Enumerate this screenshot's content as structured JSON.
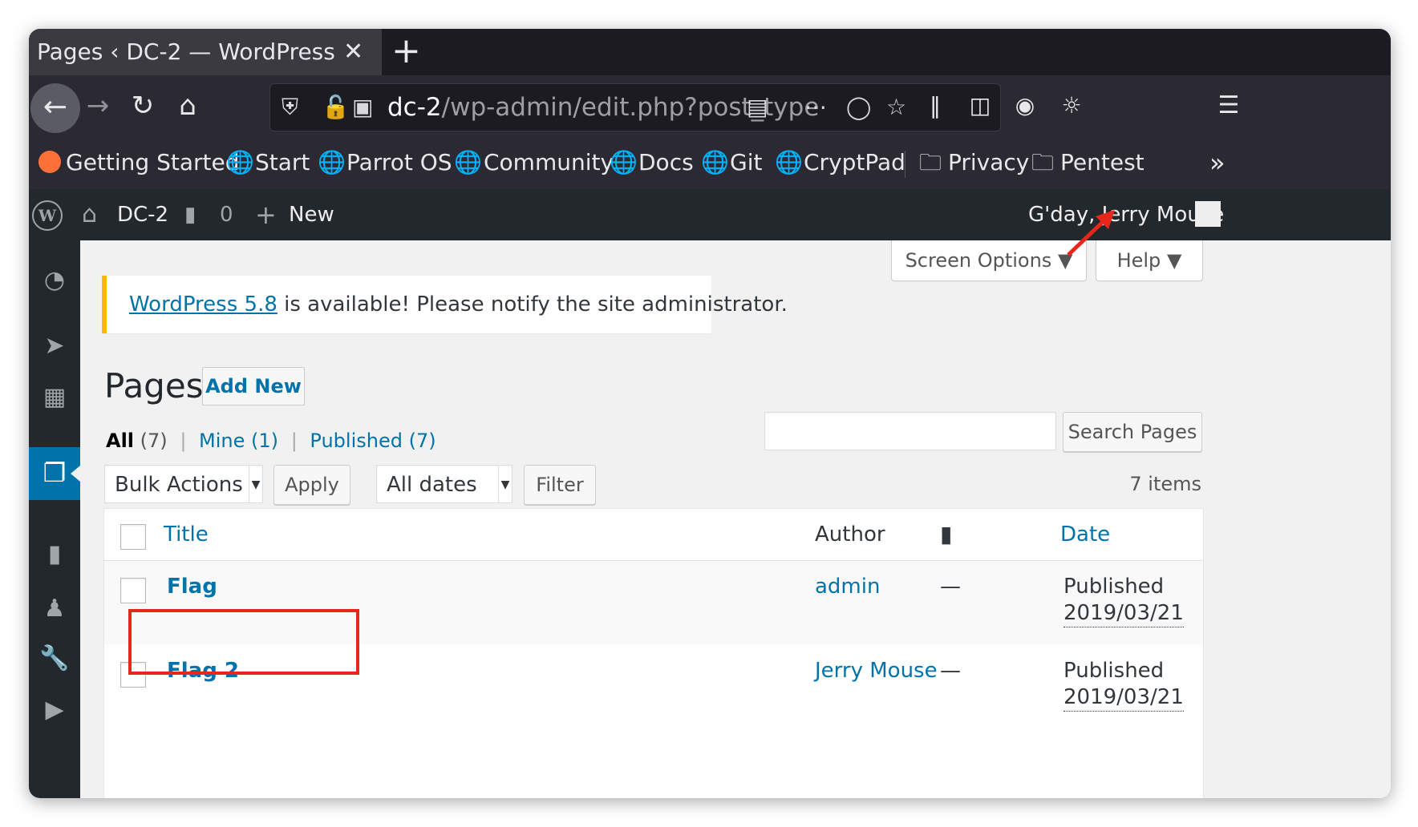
{
  "browser": {
    "tab_title": "Pages ‹ DC-2 — WordPress",
    "tab_close": "✕",
    "new_tab": "+",
    "url_host": "dc-2",
    "url_path": "/wp-admin/edit.php?post_type",
    "bookmarks": [
      "Getting Started",
      "Start",
      "Parrot OS",
      "Community",
      "Docs",
      "Git",
      "CryptPad",
      "Privacy",
      "Pentest"
    ],
    "bookmarks_more": "»"
  },
  "adminbar": {
    "site_name": "DC-2",
    "comments_count": "0",
    "new_label": "New",
    "greeting": "G'day, Jerry Mouse"
  },
  "header": {
    "screen_options": "Screen Options",
    "help": "Help"
  },
  "notice": {
    "link": "WordPress 5.8",
    "text": " is available! Please notify the site administrator."
  },
  "page": {
    "title": "Pages",
    "add_new": "Add New",
    "filters": {
      "all_label": "All",
      "all_count": "(7)",
      "mine_label": "Mine",
      "mine_count": "(1)",
      "published_label": "Published",
      "published_count": "(7)",
      "separator": "|"
    },
    "search_button": "Search Pages",
    "bulk_actions": "Bulk Actions",
    "apply": "Apply",
    "all_dates": "All dates",
    "filter": "Filter",
    "items_count": "7 items"
  },
  "table": {
    "headers": {
      "title": "Title",
      "author": "Author",
      "date": "Date"
    },
    "rows": [
      {
        "title": "Flag",
        "author": "admin",
        "comments": "—",
        "status": "Published",
        "date": "2019/03/21"
      },
      {
        "title": "Flag 2",
        "author": "Jerry Mouse",
        "comments": "—",
        "status": "Published",
        "date": "2019/03/21"
      }
    ]
  },
  "colors": {
    "wp_link": "#0073aa",
    "admin_bar": "#23282d",
    "notice_border": "#ffb900",
    "annotation": "#e8271c"
  }
}
